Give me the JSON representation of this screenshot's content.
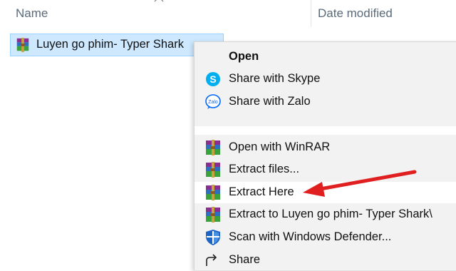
{
  "header": {
    "col_name": "Name",
    "col_date": "Date modified"
  },
  "file": {
    "name": "Luyen go phim- Typer Shark",
    "icon": "winrar-archive-icon"
  },
  "context_menu": {
    "items": [
      {
        "label": "Open",
        "icon": "none",
        "bold": true
      },
      {
        "label": "Share with Skype",
        "icon": "skype-icon"
      },
      {
        "label": "Share with Zalo",
        "icon": "zalo-icon"
      },
      {
        "label": "Open with WinRAR",
        "icon": "winrar-icon"
      },
      {
        "label": "Extract files...",
        "icon": "winrar-icon"
      },
      {
        "label": "Extract Here",
        "icon": "winrar-icon",
        "highlighted": true
      },
      {
        "label": "Extract to Luyen go phim- Typer Shark\\",
        "icon": "winrar-icon"
      },
      {
        "label": "Scan with Windows Defender...",
        "icon": "windows-defender-shield-icon"
      },
      {
        "label": "Share",
        "icon": "share-icon"
      }
    ]
  },
  "colors": {
    "selection_bg": "#cde8ff",
    "selection_border": "#99d1ff",
    "menu_bg": "#f2f2f2",
    "annotation_arrow": "#e02020",
    "skype_blue": "#00aff0",
    "zalo_blue": "#0068ff"
  }
}
